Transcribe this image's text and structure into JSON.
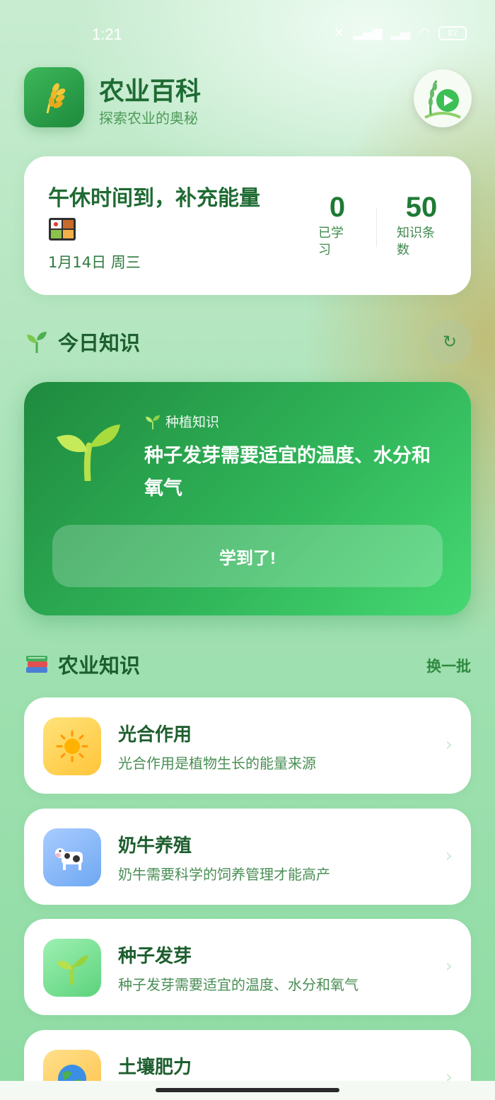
{
  "status": {
    "time": "1:21",
    "battery": "82"
  },
  "header": {
    "title": "农业百科",
    "subtitle": "探索农业的奥秘"
  },
  "greeting": {
    "message": "午休时间到，补充能量",
    "date": "1月14日 周三",
    "stats": [
      {
        "value": "0",
        "label_line1": "已学",
        "label_line2": "习"
      },
      {
        "value": "50",
        "label_line1": "知识条",
        "label_line2": "数"
      }
    ]
  },
  "today": {
    "section_title": "今日知识",
    "category": "种植知识",
    "fact": "种子发芽需要适宜的温度、水分和氧气",
    "button": "学到了!"
  },
  "knowledge": {
    "section_title": "农业知识",
    "switch_label": "换一批",
    "items": [
      {
        "title": "光合作用",
        "desc": "光合作用是植物生长的能量来源",
        "icon": "sun-icon",
        "color": "#ffd45a"
      },
      {
        "title": "奶牛养殖",
        "desc": "奶牛需要科学的饲养管理才能高产",
        "icon": "cow-icon",
        "color": "#8ab8f5"
      },
      {
        "title": "种子发芽",
        "desc": "种子发芽需要适宜的温度、水分和氧气",
        "icon": "seedling-icon",
        "color": "#7fe09a"
      },
      {
        "title": "土壤肥力",
        "desc": "",
        "icon": "globe-icon",
        "color": "#ffd67a"
      }
    ]
  },
  "colors": {
    "primary": "#1f7a35",
    "accent": "#45d872"
  }
}
